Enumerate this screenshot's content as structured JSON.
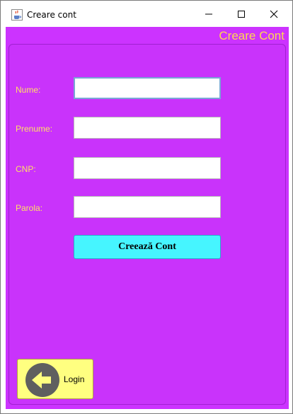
{
  "window": {
    "title": "Creare cont",
    "icon": "java-cup-icon",
    "controls": [
      "minimize-icon",
      "maximize-icon",
      "close-icon"
    ]
  },
  "header": {
    "label": "Creare Cont"
  },
  "form": {
    "fields": [
      {
        "label": "Nume:",
        "value": "",
        "focused": true
      },
      {
        "label": "Prenume:",
        "value": ""
      },
      {
        "label": "CNP:",
        "value": ""
      },
      {
        "label": "Parola:",
        "value": ""
      }
    ],
    "submit_label": "Creează Cont"
  },
  "login_button": {
    "label": "Login",
    "icon": "back-arrow-icon"
  },
  "colors": {
    "background": "#cc33ff",
    "label_text": "#ffe066",
    "header_text": "#ffd84d",
    "create_button": "#46f5ff",
    "login_button": "#ffff80"
  }
}
